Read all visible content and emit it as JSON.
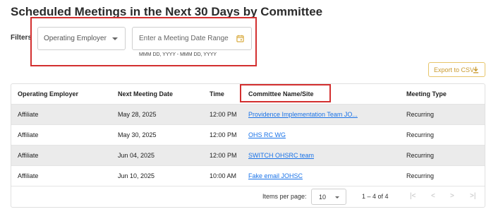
{
  "page": {
    "title": "Scheduled Meetings in the Next 30 Days by Committee"
  },
  "filters": {
    "label": "Filters",
    "employer_select": "Operating Employer",
    "date_placeholder": "Enter a Meeting Date Range",
    "date_hint": "MMM DD, YYYY - MMM DD, YYYY"
  },
  "toolbar": {
    "export_label": "Export to CSV"
  },
  "table": {
    "headers": [
      "Operating Employer",
      "Next Meeting Date",
      "Time",
      "Committee Name/Site",
      "Meeting Type"
    ],
    "rows": [
      [
        "Affiliate",
        "May 28, 2025",
        "12:00 PM",
        "Providence Implementation Team JO...",
        "Recurring"
      ],
      [
        "Affiliate",
        "May 30, 2025",
        "12:00 PM",
        "OHS RC WG",
        "Recurring"
      ],
      [
        "Affiliate",
        "Jun 04, 2025",
        "12:00 PM",
        "SWITCH OHSRC team",
        "Recurring"
      ],
      [
        "Affiliate",
        "Jun 10, 2025",
        "10:00 AM",
        "Fake email JOHSC",
        "Recurring"
      ]
    ]
  },
  "pagination": {
    "items_per_page_label": "Items per page:",
    "items_per_page_value": "10",
    "range": "1 – 4 of 4",
    "first": "|<",
    "prev": "<",
    "next": ">",
    "last": ">|"
  },
  "colors": {
    "highlight": "#d32f2f",
    "link": "#1a73e8",
    "accent": "#c99a2e"
  },
  "icons": {
    "date_picker": "calendar-icon",
    "export": "download-icon"
  }
}
